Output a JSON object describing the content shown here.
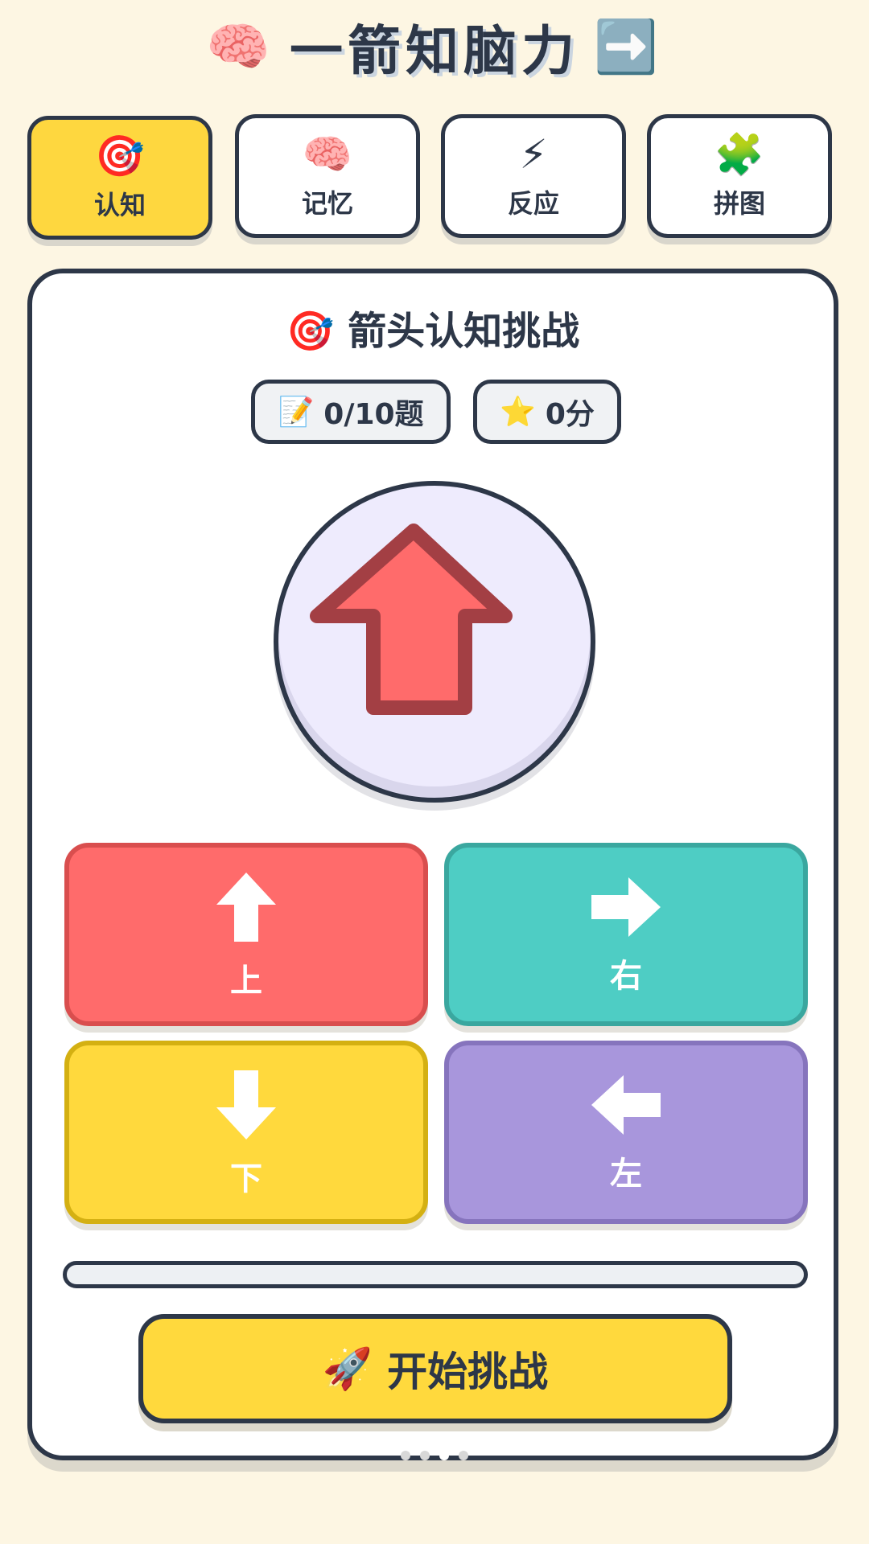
{
  "app": {
    "title": "一箭知脑力",
    "title_left_icon": "🧠",
    "title_right_icon": "➡️"
  },
  "tabs": [
    {
      "icon": "🎯",
      "label": "认知",
      "active": true
    },
    {
      "icon": "🧠",
      "label": "记忆",
      "active": false
    },
    {
      "icon": "⚡",
      "label": "反应",
      "active": false
    },
    {
      "icon": "🧩",
      "label": "拼图",
      "active": false
    }
  ],
  "game": {
    "title_icon": "🎯",
    "title": "箭头认知挑战",
    "question_icon": "📝",
    "question_progress": "0/10题",
    "score_icon": "⭐",
    "score": "0分",
    "current_arrow": "up",
    "arrow_color": "#ff6b6b",
    "arrow_stroke": "#a33f44",
    "circle_bg": "#eeebfd"
  },
  "buttons": {
    "up": {
      "label": "上",
      "icon": "arrow-up-icon",
      "color": "#ff6b6b"
    },
    "right": {
      "label": "右",
      "icon": "arrow-right-icon",
      "color": "#4ecdc4"
    },
    "down": {
      "label": "下",
      "icon": "arrow-down-icon",
      "color": "#ffd93d"
    },
    "left": {
      "label": "左",
      "icon": "arrow-left-icon",
      "color": "#a896dc"
    }
  },
  "progress": {
    "value": 0
  },
  "start": {
    "icon": "🚀",
    "label": "开始挑战"
  },
  "pager": {
    "count": 4,
    "active_index": 2
  }
}
